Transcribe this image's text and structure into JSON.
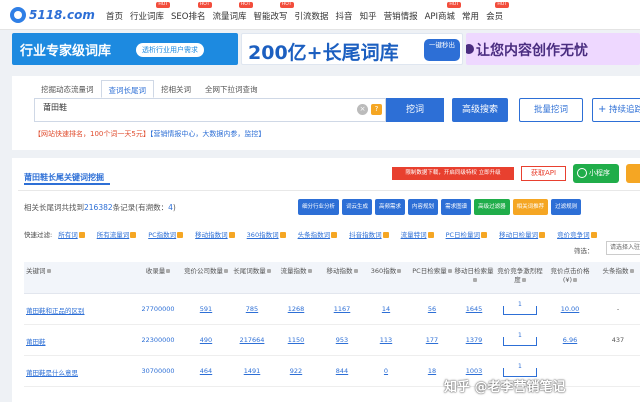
{
  "logo": {
    "text": "5118.com"
  },
  "nav": [
    "首页",
    "行业词库",
    "SEO排名",
    "流量词库",
    "智能改写",
    "引流数据",
    "抖音",
    "知乎",
    "营销情报",
    "API商城",
    "常用",
    "会员"
  ],
  "nav_hot_label": "HOT",
  "banners": {
    "b1_title": "行业专家级词库",
    "b1_pill": "透析行业用户需求",
    "b2_title": "200亿+长尾词库",
    "b2_button": "一键秒出",
    "b3_title": "让您内容创作无忧"
  },
  "tabs": [
    "挖掘动态流量词",
    "查词长尾词",
    "挖相关词",
    "全网下拉词查询"
  ],
  "search": {
    "value": "莆田鞋",
    "clear": "×",
    "help": "?"
  },
  "buttons": {
    "search": "挖词",
    "advanced": "高级搜索",
    "batch": "批量挖词",
    "continue": "持续追踪"
  },
  "notice": {
    "text1": "【网站快速排名，100个词一天5元】",
    "text2": "【营销情报中心，大数据内参，监控】"
  },
  "section": {
    "title": "莆田鞋长尾关键词挖掘",
    "red_button": "限制数据下载，开启同级特权 立即升级",
    "api_button": "获取API",
    "mini_program": "小程序"
  },
  "summary": {
    "prefix": "相关长尾词共找到",
    "count": "216382",
    "suffix": "条记录(有溯数：",
    "trace": "4",
    "end": ")"
  },
  "tool_buttons": [
    "细分行业分析",
    "词云生成",
    "高频需求",
    "内容规划",
    "需求图谱",
    "高级过滤器",
    "相关词推荐",
    "过滤规则"
  ],
  "filter_label": "快速过滤:",
  "filters": [
    "所有词",
    "所有流量词",
    "PC指数词",
    "移动指数词",
    "360指数词",
    "头条指数词",
    "抖音指数词",
    "流量特词",
    "PC日检量词",
    "移动日检量词",
    "竞价竞争词"
  ],
  "sort": {
    "label": "筛选：",
    "placeholder": "请选择入驻"
  },
  "columns": [
    "关键词",
    "收录量",
    "竞价公司数量",
    "长尾词数量",
    "流量指数",
    "移动指数",
    "360指数",
    "PC日检索量",
    "移动日检索量",
    "竞价竞争激烈程度",
    "竞价点击价格(¥)",
    "头条指数"
  ],
  "rows": [
    {
      "keyword": "莆田鞋和正品的区别",
      "indexed": "27700000",
      "bid_co": "591",
      "longtail": "785",
      "flow": "1268",
      "mobile": "1167",
      "idx360": "14",
      "pc_daily": "56",
      "mob_daily": "1645",
      "compete": "1",
      "price": "10.00",
      "toutiao": "-"
    },
    {
      "keyword": "莆田鞋",
      "indexed": "22300000",
      "bid_co": "490",
      "longtail": "217664",
      "flow": "1150",
      "mobile": "953",
      "idx360": "113",
      "pc_daily": "177",
      "mob_daily": "1379",
      "compete": "1",
      "price": "6.96",
      "toutiao": "437"
    },
    {
      "keyword": "莆田鞋是什么意思",
      "indexed": "30700000",
      "bid_co": "464",
      "longtail": "1491",
      "flow": "922",
      "mobile": "844",
      "idx360": "0",
      "pc_daily": "18",
      "mob_daily": "1003",
      "compete": "1",
      "price": "",
      "toutiao": ""
    }
  ],
  "watermark": "知乎 @老李营销笔记"
}
